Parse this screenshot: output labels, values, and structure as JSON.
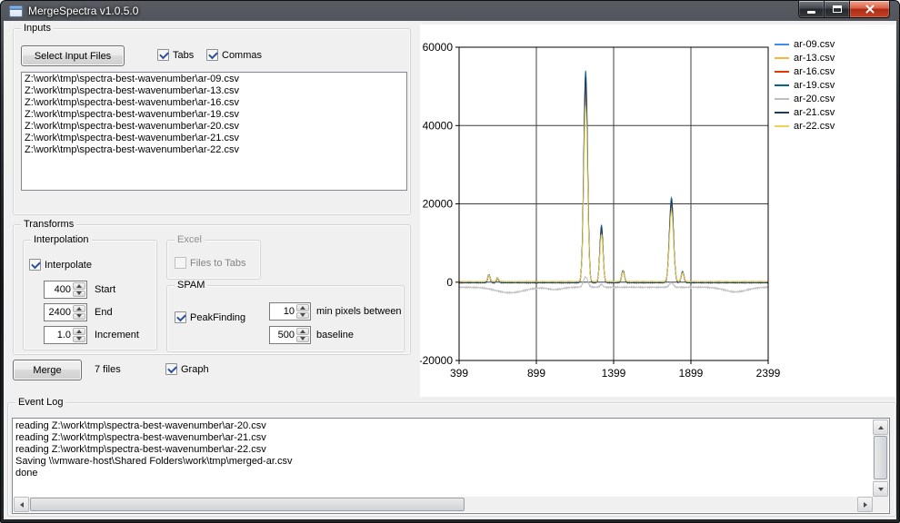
{
  "window": {
    "title": "MergeSpectra v1.0.5.0"
  },
  "inputs": {
    "title": "Inputs",
    "select_button": "Select Input Files",
    "tabs_checkbox": {
      "label": "Tabs",
      "checked": true
    },
    "commas_checkbox": {
      "label": "Commas",
      "checked": true
    },
    "files": [
      "Z:\\work\\tmp\\spectra-best-wavenumber\\ar-09.csv",
      "Z:\\work\\tmp\\spectra-best-wavenumber\\ar-13.csv",
      "Z:\\work\\tmp\\spectra-best-wavenumber\\ar-16.csv",
      "Z:\\work\\tmp\\spectra-best-wavenumber\\ar-19.csv",
      "Z:\\work\\tmp\\spectra-best-wavenumber\\ar-20.csv",
      "Z:\\work\\tmp\\spectra-best-wavenumber\\ar-21.csv",
      "Z:\\work\\tmp\\spectra-best-wavenumber\\ar-22.csv"
    ]
  },
  "transforms": {
    "title": "Transforms",
    "interpolation": {
      "title": "Interpolation",
      "interpolate_checkbox": {
        "label": "Interpolate",
        "checked": true
      },
      "start": {
        "value": "400",
        "label": "Start"
      },
      "end": {
        "value": "2400",
        "label": "End"
      },
      "increment": {
        "value": "1.0",
        "label": "Increment"
      }
    },
    "excel": {
      "title": "Excel",
      "files_to_tabs_checkbox": {
        "label": "Files to Tabs",
        "checked": false
      }
    },
    "spam": {
      "title": "SPAM",
      "peakfinding_checkbox": {
        "label": "PeakFinding",
        "checked": true
      },
      "min_pixels": {
        "value": "10",
        "label": "min pixels between"
      },
      "baseline": {
        "value": "500",
        "label": "baseline"
      }
    }
  },
  "actions": {
    "merge_button": "Merge",
    "files_count": "7 files",
    "graph_checkbox": {
      "label": "Graph",
      "checked": true
    }
  },
  "event_log": {
    "title": "Event Log",
    "lines": [
      "reading Z:\\work\\tmp\\spectra-best-wavenumber\\ar-20.csv",
      "reading Z:\\work\\tmp\\spectra-best-wavenumber\\ar-21.csv",
      "reading Z:\\work\\tmp\\spectra-best-wavenumber\\ar-22.csv",
      "Saving \\\\vmware-host\\Shared Folders\\work\\tmp\\merged-ar.csv",
      "done"
    ]
  },
  "chart_data": {
    "type": "line",
    "title": "",
    "xlabel": "",
    "ylabel": "",
    "xlim": [
      399,
      2399
    ],
    "ylim": [
      -20000,
      60000
    ],
    "x_ticks": [
      399,
      899,
      1399,
      1899,
      2399
    ],
    "y_ticks": [
      -20000,
      0,
      20000,
      40000,
      60000
    ],
    "grid": true,
    "legend_position": "right",
    "series": [
      {
        "name": "ar-09.csv",
        "color": "#418CF0",
        "baseline": 0,
        "noise": 120,
        "peaks": [
          [
            592,
            1750,
            8
          ],
          [
            648,
            1000,
            7
          ],
          [
            1218,
            50000,
            12
          ],
          [
            1320,
            13500,
            10
          ],
          [
            1460,
            2750,
            9
          ],
          [
            1773,
            20000,
            13
          ],
          [
            1845,
            2500,
            9
          ]
        ]
      },
      {
        "name": "ar-13.csv",
        "color": "#FCB441",
        "baseline": -100,
        "noise": 120,
        "peaks": [
          [
            592,
            1680,
            8
          ],
          [
            648,
            960,
            7
          ],
          [
            1218,
            48000,
            12
          ],
          [
            1320,
            12960,
            10
          ],
          [
            1460,
            2640,
            9
          ],
          [
            1773,
            19200,
            13
          ],
          [
            1845,
            2400,
            9
          ]
        ]
      },
      {
        "name": "ar-16.csv",
        "color": "#DF3A01",
        "baseline": 100,
        "noise": 120,
        "peaks": [
          [
            592,
            1770,
            8
          ],
          [
            648,
            1010,
            7
          ],
          [
            1218,
            50500,
            12
          ],
          [
            1320,
            13640,
            10
          ],
          [
            1460,
            2780,
            9
          ],
          [
            1773,
            20200,
            13
          ],
          [
            1845,
            2530,
            9
          ]
        ]
      },
      {
        "name": "ar-19.csv",
        "color": "#056492",
        "baseline": 0,
        "noise": 120,
        "peaks": [
          [
            592,
            1890,
            8
          ],
          [
            648,
            1080,
            7
          ],
          [
            1218,
            54000,
            12
          ],
          [
            1320,
            14580,
            10
          ],
          [
            1460,
            2970,
            9
          ],
          [
            1773,
            21600,
            13
          ],
          [
            1845,
            2700,
            9
          ]
        ]
      },
      {
        "name": "ar-20.csv",
        "color": "#BFBFBF",
        "baseline": -1300,
        "noise": 220,
        "peaks": [
          [
            730,
            -1400,
            90
          ],
          [
            1020,
            -600,
            45
          ],
          [
            1218,
            2600,
            14
          ],
          [
            1320,
            700,
            10
          ],
          [
            1773,
            1100,
            13
          ],
          [
            2190,
            -1200,
            70
          ]
        ]
      },
      {
        "name": "ar-21.csv",
        "color": "#1A3B69",
        "baseline": -150,
        "noise": 120,
        "peaks": [
          [
            592,
            1840,
            8
          ],
          [
            648,
            1050,
            7
          ],
          [
            1218,
            52500,
            12
          ],
          [
            1320,
            14180,
            10
          ],
          [
            1460,
            2890,
            9
          ],
          [
            1773,
            21000,
            13
          ],
          [
            1845,
            2630,
            9
          ]
        ]
      },
      {
        "name": "ar-22.csv",
        "color": "#EFD153",
        "baseline": 150,
        "noise": 120,
        "peaks": [
          [
            592,
            1580,
            8
          ],
          [
            648,
            900,
            7
          ],
          [
            1218,
            45000,
            12
          ],
          [
            1320,
            12150,
            10
          ],
          [
            1460,
            2480,
            9
          ],
          [
            1773,
            18000,
            13
          ],
          [
            1845,
            2250,
            9
          ]
        ]
      }
    ]
  }
}
